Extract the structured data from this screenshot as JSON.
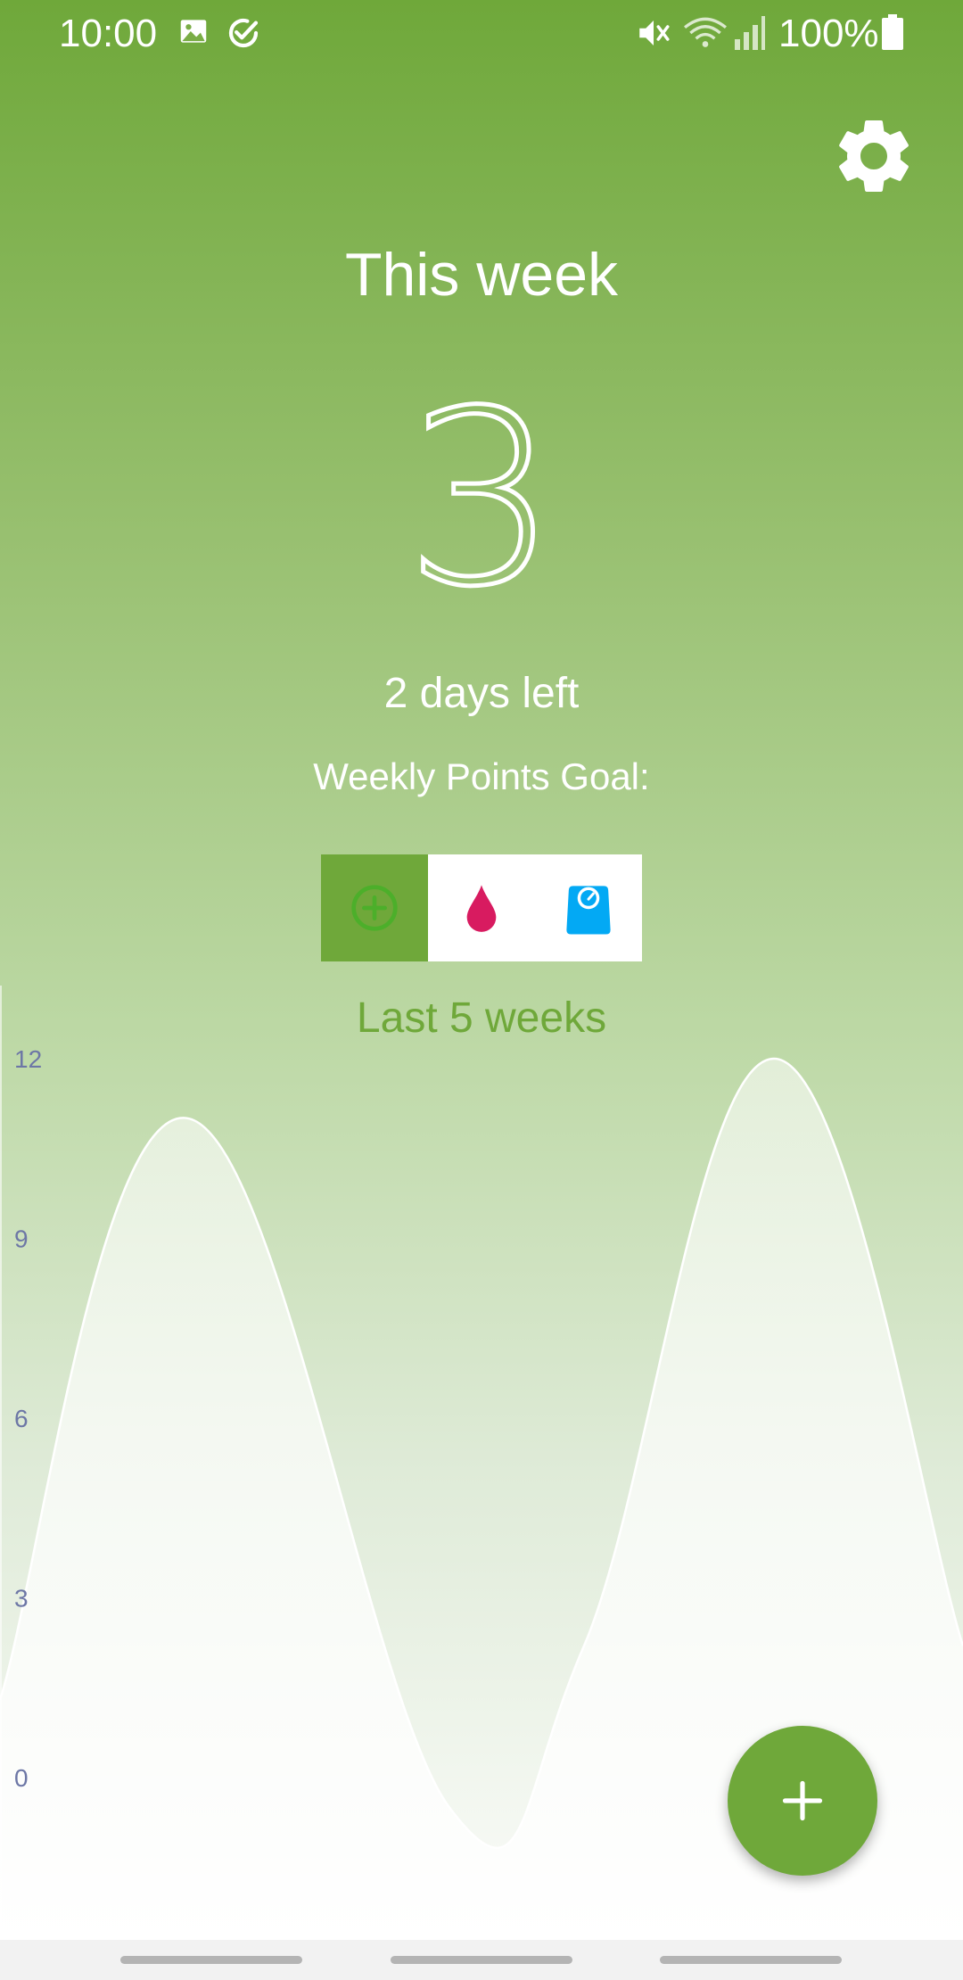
{
  "status_bar": {
    "time": "10:00",
    "battery": "100%",
    "icons": [
      "image-icon",
      "check-circle-icon",
      "mute-icon",
      "wifi-icon",
      "signal-icon",
      "battery-icon"
    ]
  },
  "header": {
    "settings_icon": "gear-icon"
  },
  "summary": {
    "title": "This week",
    "points": "3",
    "days_left": "2 days left",
    "goal_label": "Weekly Points Goal:"
  },
  "tracker_tabs": [
    {
      "icon": "add-circle-icon",
      "selected": true,
      "color": "#4caf2a"
    },
    {
      "icon": "drop-icon",
      "selected": false,
      "color": "#d81b60"
    },
    {
      "icon": "scale-icon",
      "selected": false,
      "color": "#03a9f4"
    }
  ],
  "chart_data": {
    "type": "area",
    "title": "Last 5 weeks",
    "x": [
      1,
      2,
      3,
      4,
      5
    ],
    "values": [
      11,
      -0.5,
      2.2,
      12,
      2.2
    ],
    "yticks": [
      "12",
      "9",
      "6",
      "3",
      "0"
    ],
    "ylim": [
      -0.5,
      12
    ],
    "grid": false,
    "line_color": "#ffffff"
  },
  "fab": {
    "icon": "plus-icon"
  },
  "colors": {
    "accent": "#6fa83a",
    "tick_text": "#6d77a6"
  }
}
